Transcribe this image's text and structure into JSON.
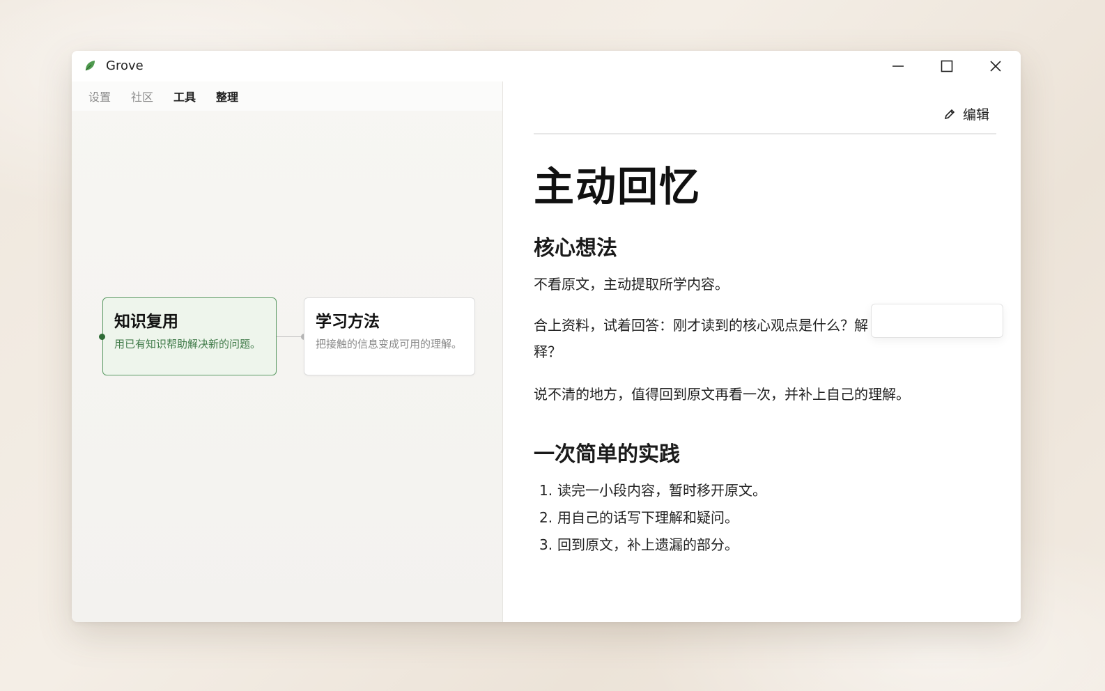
{
  "window": {
    "title": "Grove",
    "controls": {
      "minimize": "minimize-icon",
      "maximize": "maximize-icon",
      "close": "close-icon"
    }
  },
  "tabs": [
    {
      "label": "设置",
      "style": "muted"
    },
    {
      "label": "社区",
      "style": "muted"
    },
    {
      "label": "工具",
      "style": "bold"
    },
    {
      "label": "整理",
      "style": "bold"
    }
  ],
  "canvas": {
    "nodes": [
      {
        "title": "知识复用",
        "description": "用已有知识帮助解决新的问题。",
        "selected": true,
        "accent": "#5a9a63"
      },
      {
        "title": "学习方法",
        "description": "把接触的信息变成可用的理解。",
        "selected": false
      }
    ]
  },
  "doc": {
    "edit_label": "编辑",
    "title": "主动回忆",
    "section1": {
      "heading": "核心想法",
      "p1": "不看原文，主动提取所学内容。",
      "p2": "合上资料，试着回答：刚才读到的核心观点是什么？解释？",
      "p3": "说不清的地方，值得回到原文再看一次，并补上自己的理解。"
    },
    "section2": {
      "heading": "一次简单的实践",
      "items": [
        {
          "num": "1.",
          "text": "读完一小段内容，暂时移开原文。"
        },
        {
          "num": "2.",
          "text": "用自己的话写下理解和疑问。"
        },
        {
          "num": "3.",
          "text": "回到原文，补上遗漏的部分。"
        }
      ]
    }
  },
  "colors": {
    "brand": "#5a9a63",
    "node_selected_bg": "#eef5ec"
  }
}
